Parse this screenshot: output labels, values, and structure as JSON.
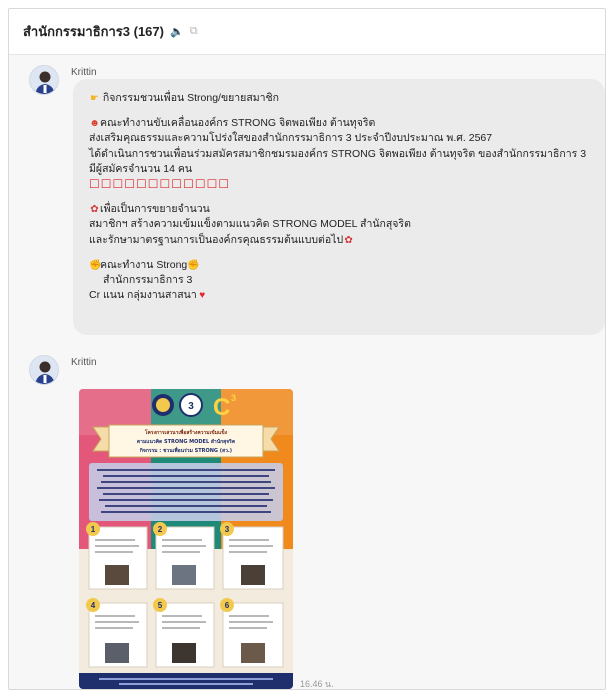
{
  "header": {
    "title": "สำนักกรรมาธิการ3 (167)",
    "icons": [
      "mute-icon",
      "copy-icon"
    ]
  },
  "messages": [
    {
      "sender": "Krittin",
      "lines": [
        "กิจกรรมชวนเพื่อน Strong/ขยายสมาชิก",
        "คณะทำงานขับเคลื่อนองค์กร STRONG จิตพอเพียง ต้านทุจริต",
        "ส่งเสริมคุณธรรมและความโปร่งใสของสำนักกรรมาธิการ 3 ประจำปีงบประมาณ พ.ศ. 2567",
        "ได้ดำเนินการชวนเพื่อนร่วมสมัครสมาชิกชมรมองค์กร STRONG จิตพอเพียง ต้านทุจริต ของสำนักกรรมาธิการ 3",
        "มีผู้สมัครจำนวน 14 คน",
        "เพื่อเป็นการขยายจำนวน",
        "สมาชิกฯ สร้างความเข้มแข็งตามแนวคิด STRONG MODEL สำนักสุจริต",
        "และรักษามาตรฐานการเป็นองค์กรคุณธรรมต้นแบบต่อไป",
        "คณะทำงาน Strong",
        "สำนักกรรมาธิการ 3",
        "Cr แนน กลุ่มงานสาสนา"
      ],
      "boxes": "☐☐☐☐☐☐☐☐☐☐☐☐"
    },
    {
      "sender": "Krittin",
      "timestamp": "16.46 น.",
      "poster": {
        "c_label": "C",
        "c_superscript": "3",
        "badge_number": "3",
        "ribbon_line1": "โครงการเสวนาเพื่อสร้างความเข้มแข็ง",
        "ribbon_line2": "ตามแนวคิด STRONG MODEL สำนักสุจริต",
        "ribbon_line3": "กิจกรรม : ชวนเพื่อนร่วม STRONG (สว.)",
        "card_numbers": [
          "1",
          "2",
          "3",
          "4",
          "5",
          "6"
        ]
      }
    }
  ],
  "colors": {
    "bubble": "#ebebeb",
    "poster_orange": "#f08a1c",
    "poster_pink": "#d2436b",
    "poster_green": "#1e8a78",
    "poster_navy": "#1f2f6e"
  }
}
